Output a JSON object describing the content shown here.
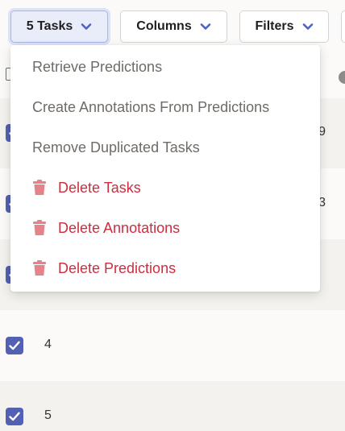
{
  "toolbar": {
    "tasks_label": "5 Tasks",
    "columns_label": "Columns",
    "filters_label": "Filters"
  },
  "dropdown": {
    "items": [
      {
        "label": "Retrieve Predictions",
        "danger": false
      },
      {
        "label": "Create Annotations From Predictions",
        "danger": false
      },
      {
        "label": "Remove Duplicated Tasks",
        "danger": false
      },
      {
        "label": "Delete Tasks",
        "danger": true,
        "icon": "trash-icon"
      },
      {
        "label": "Delete Annotations",
        "danger": true,
        "icon": "trash-icon"
      },
      {
        "label": "Delete Predictions",
        "danger": true,
        "icon": "trash-icon"
      }
    ]
  },
  "table": {
    "rows": [
      {
        "id": "",
        "checked": true,
        "trailing": "9"
      },
      {
        "id": "",
        "checked": true,
        "trailing": "3"
      },
      {
        "id": "",
        "checked": true,
        "trailing": ""
      },
      {
        "id": "4",
        "checked": true,
        "trailing": ""
      },
      {
        "id": "5",
        "checked": true,
        "trailing": ""
      }
    ]
  },
  "colors": {
    "accent": "#5261b3",
    "danger": "#cc2d3f",
    "danger_icon": "#e5838b",
    "muted_text": "#6f6b67"
  }
}
